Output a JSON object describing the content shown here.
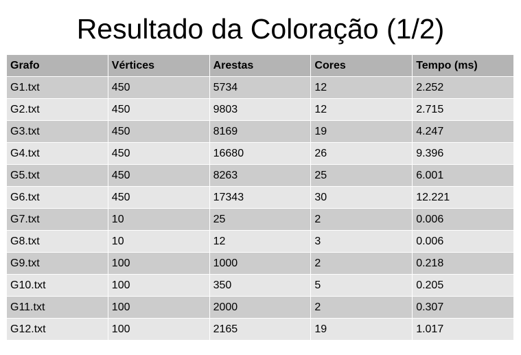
{
  "title": "Resultado da Coloração (1/2)",
  "table": {
    "headers": [
      "Grafo",
      "Vértices",
      "Arestas",
      "Cores",
      "Tempo (ms)"
    ],
    "rows": [
      [
        "G1.txt",
        "450",
        "5734",
        "12",
        "2.252"
      ],
      [
        "G2.txt",
        "450",
        "9803",
        "12",
        "2.715"
      ],
      [
        "G3.txt",
        "450",
        "8169",
        "19",
        "4.247"
      ],
      [
        "G4.txt",
        "450",
        "16680",
        "26",
        "9.396"
      ],
      [
        "G5.txt",
        "450",
        "8263",
        "25",
        "6.001"
      ],
      [
        "G6.txt",
        "450",
        "17343",
        "30",
        "12.221"
      ],
      [
        "G7.txt",
        "10",
        "25",
        "2",
        "0.006"
      ],
      [
        "G8.txt",
        "10",
        "12",
        "3",
        "0.006"
      ],
      [
        "G9.txt",
        "100",
        "1000",
        "2",
        "0.218"
      ],
      [
        "G10.txt",
        "100",
        "350",
        "5",
        "0.205"
      ],
      [
        "G11.txt",
        "100",
        "2000",
        "2",
        "0.307"
      ],
      [
        "G12.txt",
        "100",
        "2165",
        "19",
        "1.017"
      ]
    ]
  },
  "colors": {
    "header_bg": "#b4b4b4",
    "row_dark_bg": "#cccccc",
    "row_light_bg": "#e6e6e6"
  }
}
